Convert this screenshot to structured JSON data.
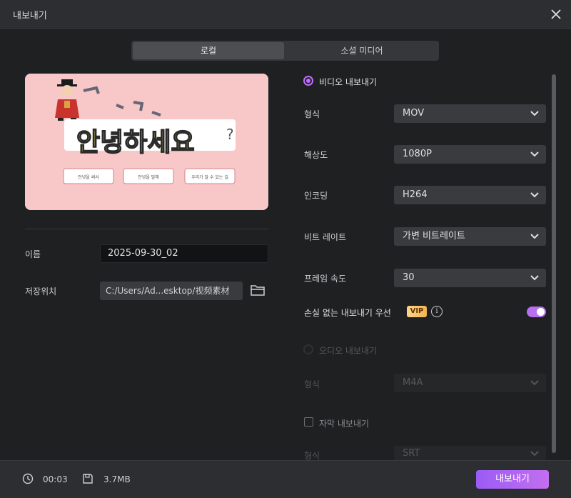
{
  "window": {
    "title": "내보내기"
  },
  "tabs": [
    {
      "label": "로컬"
    },
    {
      "label": "소셜 미디어"
    }
  ],
  "preview": {
    "headline": "안녕하세요",
    "mini_buttons": [
      "안녕을 써서",
      "안녕을 말해",
      "우리가 잘 수 있는 길"
    ]
  },
  "left": {
    "name_label": "이름",
    "name_value": "2025-09-30_02",
    "location_label": "저장위치",
    "location_value": "C:/Users/Ad...esktop/视频素材"
  },
  "video": {
    "section_label": "비디오 내보내기",
    "rows": [
      {
        "label": "형식",
        "value": "MOV"
      },
      {
        "label": "해상도",
        "value": "1080P"
      },
      {
        "label": "인코딩",
        "value": "H264"
      },
      {
        "label": "비트 레이트",
        "value": "가변 비트레이트"
      },
      {
        "label": "프레임 속도",
        "value": "30"
      }
    ],
    "lossless_label": "손실 없는 내보내기 우선",
    "vip_badge": "VIP",
    "info_glyph": "i"
  },
  "audio": {
    "section_label": "오디오 내보내기",
    "format_label": "형식",
    "format_value": "M4A"
  },
  "subtitle": {
    "section_label": "자막 내보내기",
    "format_label": "형식",
    "format_value": "SRT"
  },
  "footer": {
    "duration": "00:03",
    "size": "3.7MB",
    "export_label": "내보내기"
  },
  "colors": {
    "accent": "#b76ff0",
    "preview_bg": "#f8c7c8",
    "vip": "#f3b451"
  }
}
